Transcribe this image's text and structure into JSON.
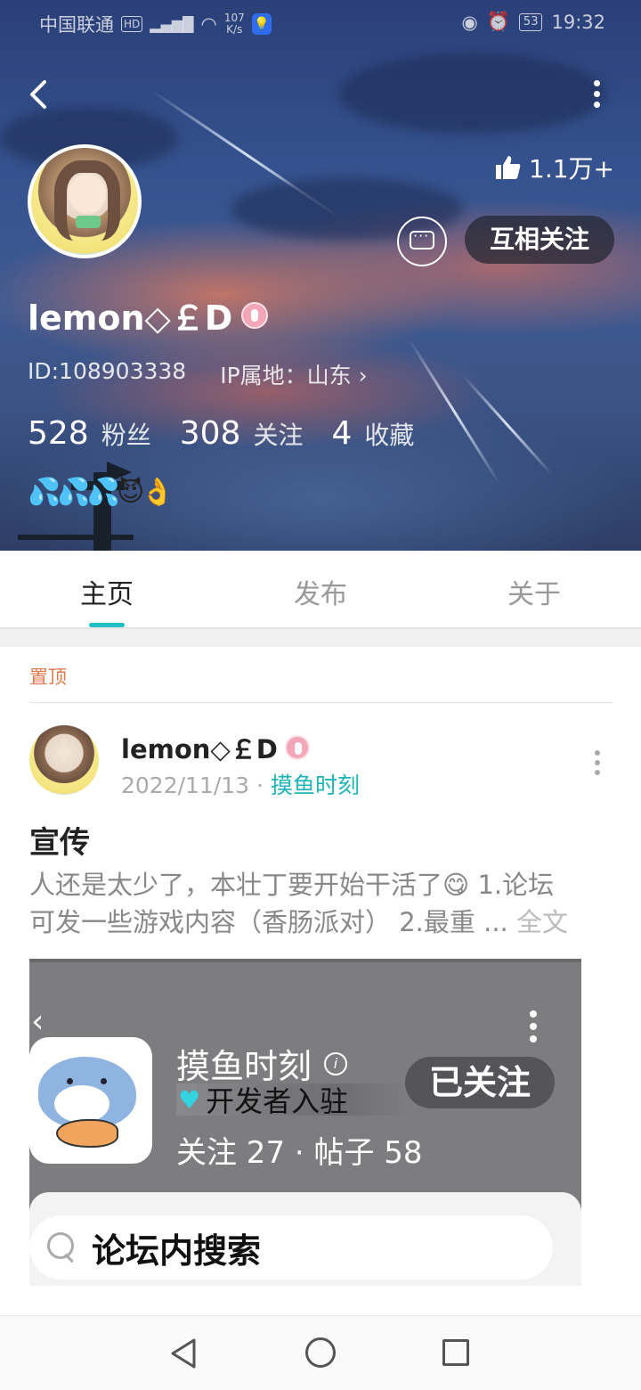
{
  "status_bar": {
    "carrier": "中国联通",
    "hd": "HD",
    "signal": "⁴⁶",
    "speed_value": "107",
    "speed_unit": "K/s",
    "battery": "53",
    "time": "19:32"
  },
  "profile": {
    "likes": "1.1万+",
    "follow_button": "互相关注",
    "username": "lemon◇￡D",
    "id_text": "ID:108903338",
    "ip_text": "IP属地：山东 ›",
    "stats": [
      {
        "num": "528",
        "label": "粉丝"
      },
      {
        "num": "308",
        "label": "关注"
      },
      {
        "num": "4",
        "label": "收藏"
      }
    ],
    "bio_emojis": "💦💦💦😈👌"
  },
  "tabs": [
    {
      "label": "主页",
      "active": true
    },
    {
      "label": "发布",
      "active": false
    },
    {
      "label": "关于",
      "active": false
    }
  ],
  "post": {
    "pinned_label": "置顶",
    "author": "lemon◇￡D",
    "date": "2022/11/13",
    "topic": "摸鱼时刻",
    "title": "宣传",
    "body_line1": "人还是太少了，本壮丁要开始干活了😋 1.论坛",
    "body_line2": "可发一些游戏内容（香肠派对） 2.最重 ...",
    "full_text": "全文"
  },
  "embedded": {
    "forum_name": "摸鱼时刻",
    "dev_label": "开发者入驻",
    "forum_stats": "关注 27 · 帖子 58",
    "followed_button": "已关注",
    "search_label": "论坛内搜索"
  },
  "colors": {
    "accent": "#1fc0c3",
    "pinned": "#e07a50",
    "topic": "#1fb4b8"
  }
}
